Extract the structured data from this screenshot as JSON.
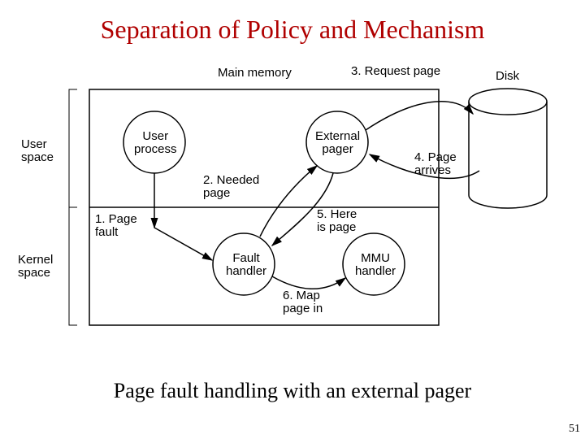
{
  "title": "Separation of Policy and Mechanism",
  "caption": "Page fault handling with an external pager",
  "page_number": "51",
  "memory_label": "Main memory",
  "disk_label": "Disk",
  "region_user": "User\nspace",
  "region_kernel": "Kernel\nspace",
  "nodes": {
    "user_process": "User\nprocess",
    "external_pager": "External\npager",
    "fault_handler": "Fault\nhandler",
    "mmu_handler": "MMU\nhandler"
  },
  "steps": {
    "s1": "1. Page\nfault",
    "s2": "2. Needed\npage",
    "s3": "3. Request page",
    "s4": "4. Page\narrives",
    "s5": "5. Here\nis page",
    "s6": "6. Map\npage in"
  }
}
